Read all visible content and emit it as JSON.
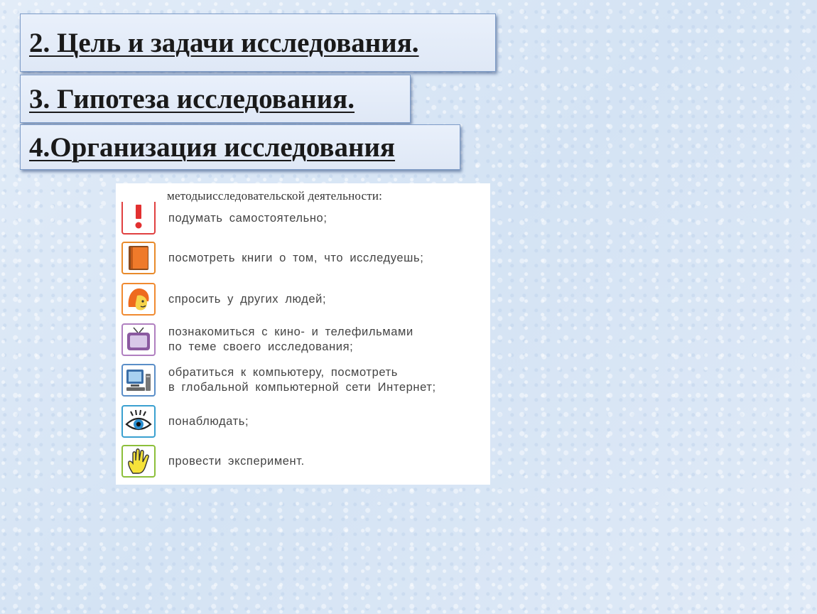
{
  "headings": [
    "2. Цель и задачи исследования.",
    "3. Гипотеза исследования.",
    "4.Организация исследования"
  ],
  "methods": {
    "title": "методыисследовательской деятельности:",
    "items": [
      {
        "icon": "exclamation-icon",
        "color": "#e04040",
        "text": "подумать самостоятельно;"
      },
      {
        "icon": "book-icon",
        "color": "#e88a2a",
        "text": "посмотреть книги о том, что исследуешь;"
      },
      {
        "icon": "person-head-icon",
        "color": "#f08a30",
        "text": "спросить у других людей;"
      },
      {
        "icon": "tv-icon",
        "color": "#b07fc0",
        "text": "познакомиться с кино- и телефильмами\nпо теме своего исследования;"
      },
      {
        "icon": "computer-icon",
        "color": "#5a8ec8",
        "text": "обратиться к компьютеру, посмотреть\nв глобальной компьютерной сети Интернет;"
      },
      {
        "icon": "eye-icon",
        "color": "#3aa0d0",
        "text": "понаблюдать;"
      },
      {
        "icon": "hand-icon",
        "color": "#8cbf3a",
        "text": "провести эксперимент."
      }
    ]
  }
}
